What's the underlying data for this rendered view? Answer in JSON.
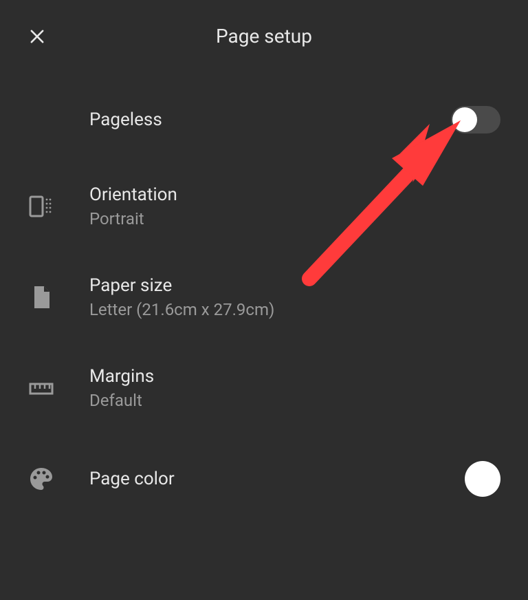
{
  "header": {
    "title": "Page setup"
  },
  "rows": {
    "pageless": {
      "label": "Pageless",
      "toggle_state": "off"
    },
    "orientation": {
      "label": "Orientation",
      "value": "Portrait"
    },
    "paper_size": {
      "label": "Paper size",
      "value": "Letter (21.6cm x 27.9cm)"
    },
    "margins": {
      "label": "Margins",
      "value": "Default"
    },
    "page_color": {
      "label": "Page color",
      "value": "#ffffff"
    }
  },
  "annotation": {
    "arrow_color": "#ff3b3b"
  }
}
